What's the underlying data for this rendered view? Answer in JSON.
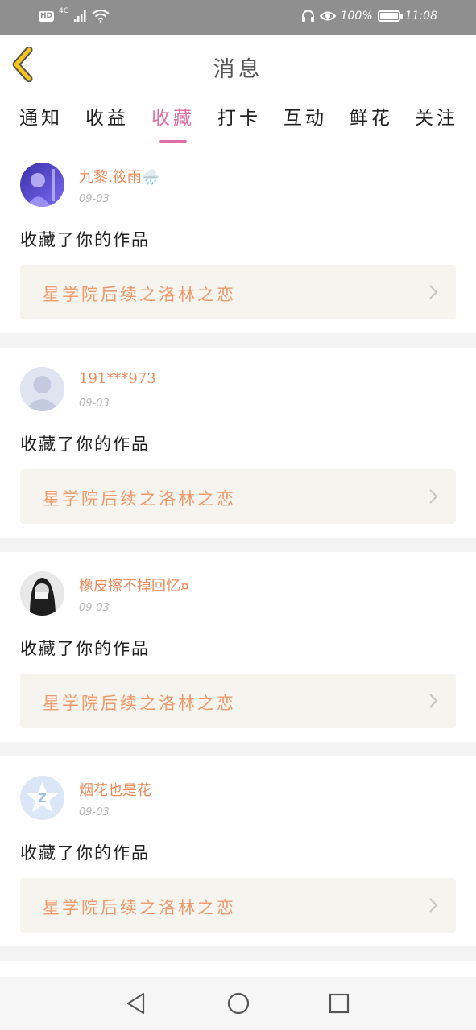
{
  "status_bar": {
    "hd_badge": "HD",
    "network": "4G",
    "battery": "100%",
    "time": "11:08",
    "icons": [
      "signal-icon",
      "wifi-icon",
      "headphones-icon",
      "eye-icon",
      "battery-icon"
    ]
  },
  "header": {
    "title": "消息",
    "back_icon": "chevron-left-icon",
    "accent_color": "#f5c518"
  },
  "tabs": [
    {
      "label": "通知",
      "active": false
    },
    {
      "label": "收益",
      "active": false
    },
    {
      "label": "收藏",
      "active": true
    },
    {
      "label": "打卡",
      "active": false
    },
    {
      "label": "互动",
      "active": false
    },
    {
      "label": "鲜花",
      "active": false
    },
    {
      "label": "关注",
      "active": false
    }
  ],
  "active_color": "#e06ea3",
  "messages": [
    {
      "username": "九黎.筱雨🌧️",
      "date": "09-03",
      "action": "收藏了你的作品",
      "work_title": "星学院后续之洛林之恋",
      "avatar": "avatar-purple-photo"
    },
    {
      "username": "191***973",
      "date": "09-03",
      "action": "收藏了你的作品",
      "work_title": "星学院后续之洛林之恋",
      "avatar": "avatar-default-silhouette"
    },
    {
      "username": "橡皮擦不掉回忆¤",
      "date": "09-03",
      "action": "收藏了你的作品",
      "work_title": "星学院后续之洛林之恋",
      "avatar": "avatar-dark-photo"
    },
    {
      "username": "烟花也是花",
      "date": "09-03",
      "action": "收藏了你的作品",
      "work_title": "星学院后续之洛林之恋",
      "avatar": "avatar-qq-star"
    }
  ],
  "nav_bar": {
    "icons": [
      "back-triangle-icon",
      "home-circle-icon",
      "recents-square-icon"
    ]
  }
}
